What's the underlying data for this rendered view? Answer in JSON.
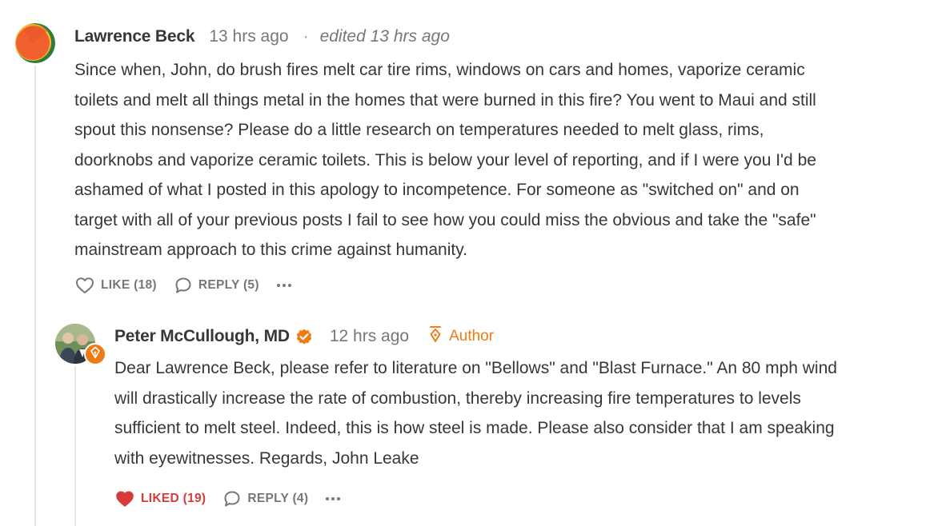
{
  "comment": {
    "author": "Lawrence Beck",
    "timestamp": "13 hrs ago",
    "separator": "·",
    "edited": "edited 13 hrs ago",
    "lines": [
      "Since when, John, do brush fires melt car tire rims, windows on cars and homes, vaporize ceramic",
      "toilets and melt all things metal in the homes that were burned in this fire? You went to Maui and still",
      "spout this nonsense? Please do a little research on temperatures needed to melt glass, rims,",
      "doorknobs and vaporize ceramic toilets. This is below your level of reporting, and if I were you I'd be",
      "ashamed of what I posted in this apology to incompetence. For someone as \"switched on\" and on",
      "target with all of your previous posts I fail to see how you could miss the obvious and take the \"safe\"",
      "mainstream approach to this crime against humanity."
    ],
    "like_label": "LIKE (18)",
    "reply_label": "REPLY (5)",
    "like_icon": "heart-outline-icon",
    "reply_icon": "speech-bubble-icon",
    "more_icon": "ellipsis-icon"
  },
  "reply": {
    "author": "Peter McCullough, MD",
    "verified_icon": "verified-check-icon",
    "timestamp": "12 hrs ago",
    "author_badge": "Author",
    "author_badge_icon": "fountain-pen-icon",
    "lines": [
      "Dear Lawrence Beck, please refer to literature on \"Bellows\" and \"Blast Furnace.\" An 80 mph wind",
      "will drastically increase the rate of combustion, thereby increasing fire temperatures to levels",
      "sufficient to melt steel. Indeed, this is how steel is made. Please also consider that I am speaking",
      "with eyewitnesses. Regards, John Leake"
    ],
    "like_label": "LIKED (19)",
    "reply_label": "REPLY (4)",
    "like_icon": "heart-filled-icon",
    "reply_icon": "speech-bubble-icon",
    "more_icon": "ellipsis-icon"
  },
  "colors": {
    "accent": "#f07a14",
    "liked": "#d73a3a",
    "text": "#363737",
    "muted": "#777777"
  }
}
